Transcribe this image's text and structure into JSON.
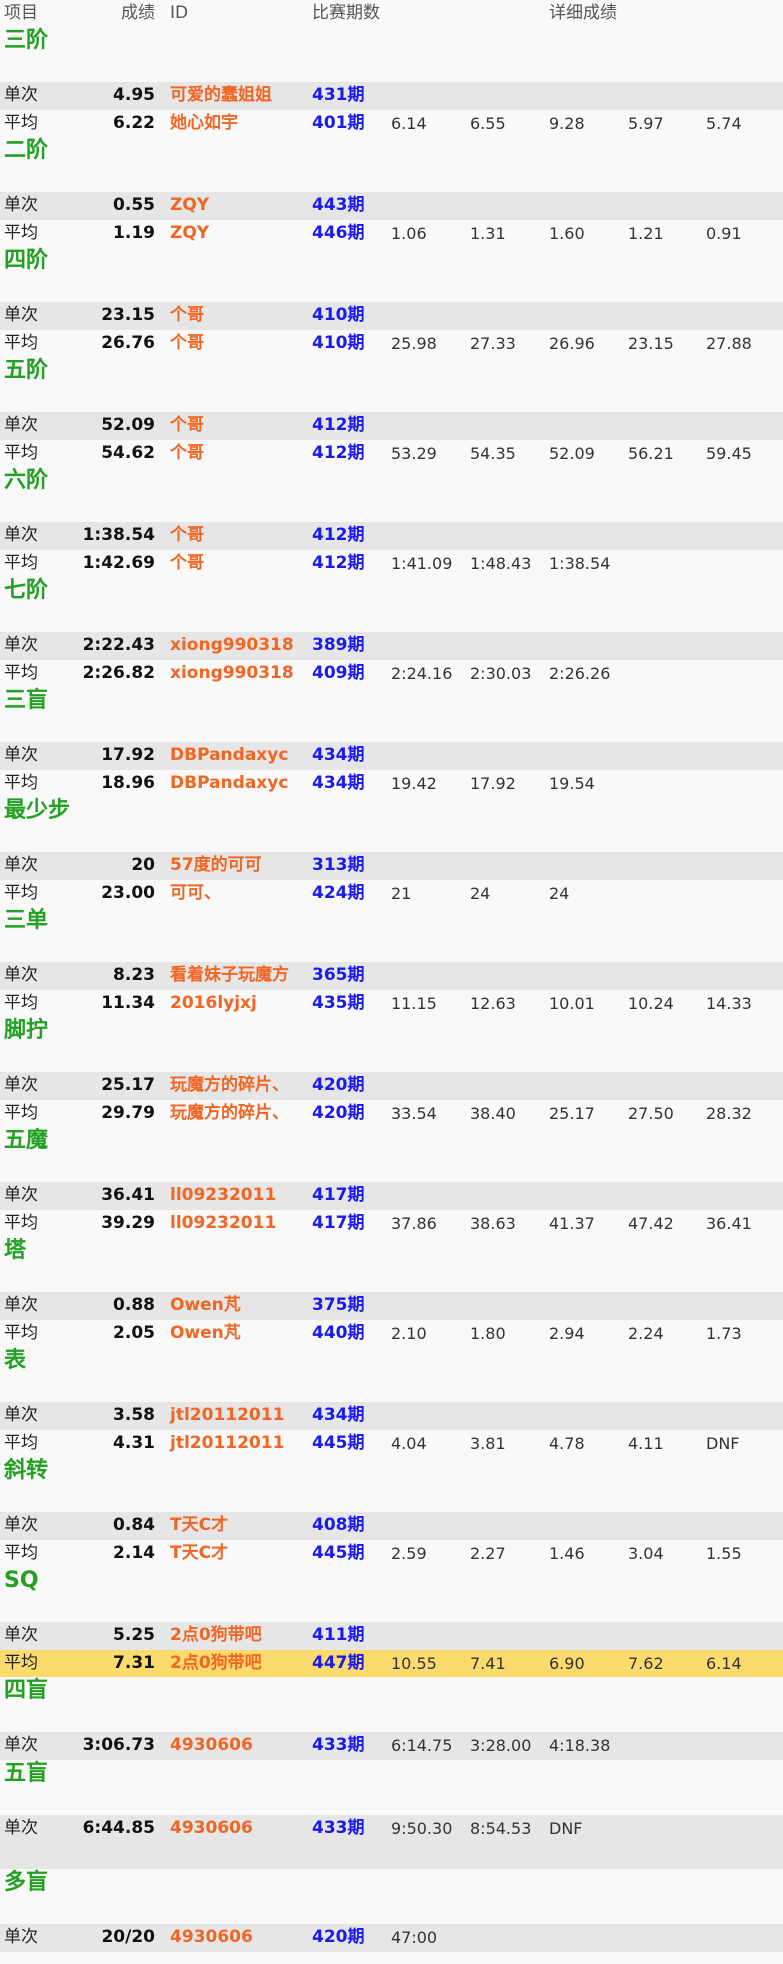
{
  "header": {
    "type": "项目",
    "result": "成绩",
    "id": "ID",
    "round": "比赛期数",
    "detail": "详细成绩"
  },
  "events": [
    {
      "name": "三阶",
      "rows": [
        {
          "type": "单次",
          "result": "4.95",
          "id": "可爱的蠢姐姐",
          "round": "431期",
          "details": []
        },
        {
          "type": "平均",
          "result": "6.22",
          "id": "她心如宇",
          "round": "401期",
          "details": [
            "6.14",
            "6.55",
            "9.28",
            "5.97",
            "5.74"
          ]
        }
      ]
    },
    {
      "name": "二阶",
      "rows": [
        {
          "type": "单次",
          "result": "0.55",
          "id": "ZQY",
          "round": "443期",
          "details": []
        },
        {
          "type": "平均",
          "result": "1.19",
          "id": "ZQY",
          "round": "446期",
          "details": [
            "1.06",
            "1.31",
            "1.60",
            "1.21",
            "0.91"
          ]
        }
      ]
    },
    {
      "name": "四阶",
      "rows": [
        {
          "type": "单次",
          "result": "23.15",
          "id": "个哥",
          "round": "410期",
          "details": []
        },
        {
          "type": "平均",
          "result": "26.76",
          "id": "个哥",
          "round": "410期",
          "details": [
            "25.98",
            "27.33",
            "26.96",
            "23.15",
            "27.88"
          ]
        }
      ]
    },
    {
      "name": "五阶",
      "rows": [
        {
          "type": "单次",
          "result": "52.09",
          "id": "个哥",
          "round": "412期",
          "details": []
        },
        {
          "type": "平均",
          "result": "54.62",
          "id": "个哥",
          "round": "412期",
          "details": [
            "53.29",
            "54.35",
            "52.09",
            "56.21",
            "59.45"
          ]
        }
      ]
    },
    {
      "name": "六阶",
      "rows": [
        {
          "type": "单次",
          "result": "1:38.54",
          "id": "个哥",
          "round": "412期",
          "details": []
        },
        {
          "type": "平均",
          "result": "1:42.69",
          "id": "个哥",
          "round": "412期",
          "details": [
            "1:41.09",
            "1:48.43",
            "1:38.54"
          ]
        }
      ]
    },
    {
      "name": "七阶",
      "rows": [
        {
          "type": "单次",
          "result": "2:22.43",
          "id": "xiong990318",
          "round": "389期",
          "details": []
        },
        {
          "type": "平均",
          "result": "2:26.82",
          "id": "xiong990318",
          "round": "409期",
          "details": [
            "2:24.16",
            "2:30.03",
            "2:26.26"
          ]
        }
      ]
    },
    {
      "name": "三盲",
      "rows": [
        {
          "type": "单次",
          "result": "17.92",
          "id": "DBPandaxyc",
          "round": "434期",
          "details": []
        },
        {
          "type": "平均",
          "result": "18.96",
          "id": "DBPandaxyc",
          "round": "434期",
          "details": [
            "19.42",
            "17.92",
            "19.54"
          ]
        }
      ]
    },
    {
      "name": "最少步",
      "rows": [
        {
          "type": "单次",
          "result": "20",
          "id": "57度的可可",
          "round": "313期",
          "details": []
        },
        {
          "type": "平均",
          "result": "23.00",
          "id": "可可、",
          "round": "424期",
          "details": [
            "21",
            "24",
            "24"
          ]
        }
      ]
    },
    {
      "name": "三单",
      "rows": [
        {
          "type": "单次",
          "result": "8.23",
          "id": "看着妹子玩魔方",
          "round": "365期",
          "details": []
        },
        {
          "type": "平均",
          "result": "11.34",
          "id": "2016lyjxj",
          "round": "435期",
          "details": [
            "11.15",
            "12.63",
            "10.01",
            "10.24",
            "14.33"
          ]
        }
      ]
    },
    {
      "name": "脚拧",
      "rows": [
        {
          "type": "单次",
          "result": "25.17",
          "id": "玩魔方的碎片、",
          "round": "420期",
          "details": []
        },
        {
          "type": "平均",
          "result": "29.79",
          "id": "玩魔方的碎片、",
          "round": "420期",
          "details": [
            "33.54",
            "38.40",
            "25.17",
            "27.50",
            "28.32"
          ]
        }
      ]
    },
    {
      "name": "五魔",
      "rows": [
        {
          "type": "单次",
          "result": "36.41",
          "id": "ll09232011",
          "round": "417期",
          "details": []
        },
        {
          "type": "平均",
          "result": "39.29",
          "id": "ll09232011",
          "round": "417期",
          "details": [
            "37.86",
            "38.63",
            "41.37",
            "47.42",
            "36.41"
          ]
        }
      ]
    },
    {
      "name": "塔",
      "rows": [
        {
          "type": "单次",
          "result": "0.88",
          "id": "Owen芃",
          "round": "375期",
          "details": []
        },
        {
          "type": "平均",
          "result": "2.05",
          "id": "Owen芃",
          "round": "440期",
          "details": [
            "2.10",
            "1.80",
            "2.94",
            "2.24",
            "1.73"
          ]
        }
      ]
    },
    {
      "name": "表",
      "rows": [
        {
          "type": "单次",
          "result": "3.58",
          "id": "jtl20112011",
          "round": "434期",
          "details": []
        },
        {
          "type": "平均",
          "result": "4.31",
          "id": "jtl20112011",
          "round": "445期",
          "details": [
            "4.04",
            "3.81",
            "4.78",
            "4.11",
            "DNF"
          ]
        }
      ]
    },
    {
      "name": "斜转",
      "rows": [
        {
          "type": "单次",
          "result": "0.84",
          "id": "T天C才",
          "round": "408期",
          "details": []
        },
        {
          "type": "平均",
          "result": "2.14",
          "id": "T天C才",
          "round": "445期",
          "details": [
            "2.59",
            "2.27",
            "1.46",
            "3.04",
            "1.55"
          ]
        }
      ]
    },
    {
      "name": "SQ",
      "rows": [
        {
          "type": "单次",
          "result": "5.25",
          "id": "2点0狗带吧",
          "round": "411期",
          "details": []
        },
        {
          "type": "平均",
          "result": "7.31",
          "id": "2点0狗带吧",
          "round": "447期",
          "details": [
            "10.55",
            "7.41",
            "6.90",
            "7.62",
            "6.14"
          ],
          "highlight": true
        }
      ]
    },
    {
      "name": "四盲",
      "rows": [
        {
          "type": "单次",
          "result": "3:06.73",
          "id": "4930606",
          "round": "433期",
          "details": [
            "6:14.75",
            "3:28.00",
            "4:18.38"
          ]
        }
      ]
    },
    {
      "name": "五盲",
      "rows": [
        {
          "type": "单次",
          "result": "6:44.85",
          "id": "4930606",
          "round": "433期",
          "details": [
            "9:50.30",
            "8:54.53",
            "DNF"
          ]
        }
      ]
    },
    {
      "name": "多盲",
      "rows": [
        {
          "type": "单次",
          "result": "20/20",
          "id": "4930606",
          "round": "420期",
          "details": [
            "47:00"
          ]
        }
      ]
    }
  ],
  "colors": {
    "section_title": "#22a022",
    "id_text": "#f26522",
    "round_text": "#1a1aee",
    "row_stripe": "#e6e6e6",
    "highlight_row": "#fcdb6e",
    "background": "#f9f9f9"
  }
}
